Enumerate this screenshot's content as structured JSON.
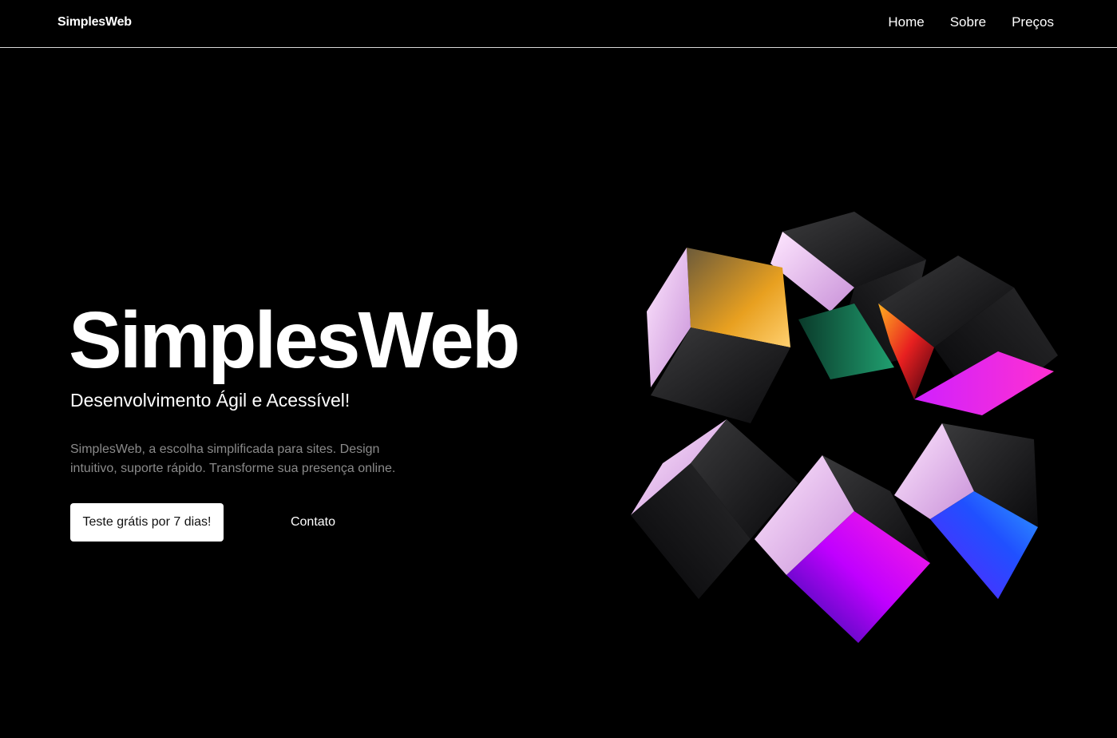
{
  "navbar": {
    "brand": "SimplesWeb",
    "links": [
      {
        "label": "Home"
      },
      {
        "label": "Sobre"
      },
      {
        "label": "Preços"
      }
    ]
  },
  "hero": {
    "title": "SimplesWeb",
    "subtitle": "Desenvolvimento Ágil e Acessível!",
    "description": "SimplesWeb, a escolha simplificada para sites. Design intuitivo, suporte rápido. Transforme sua presença online.",
    "primary_cta": "Teste grátis por 7 dias!",
    "secondary_cta": "Contato"
  },
  "colors": {
    "background": "#000000",
    "text": "#ffffff",
    "muted_text": "#8a8a8a",
    "divider": "#d9d9d9"
  }
}
